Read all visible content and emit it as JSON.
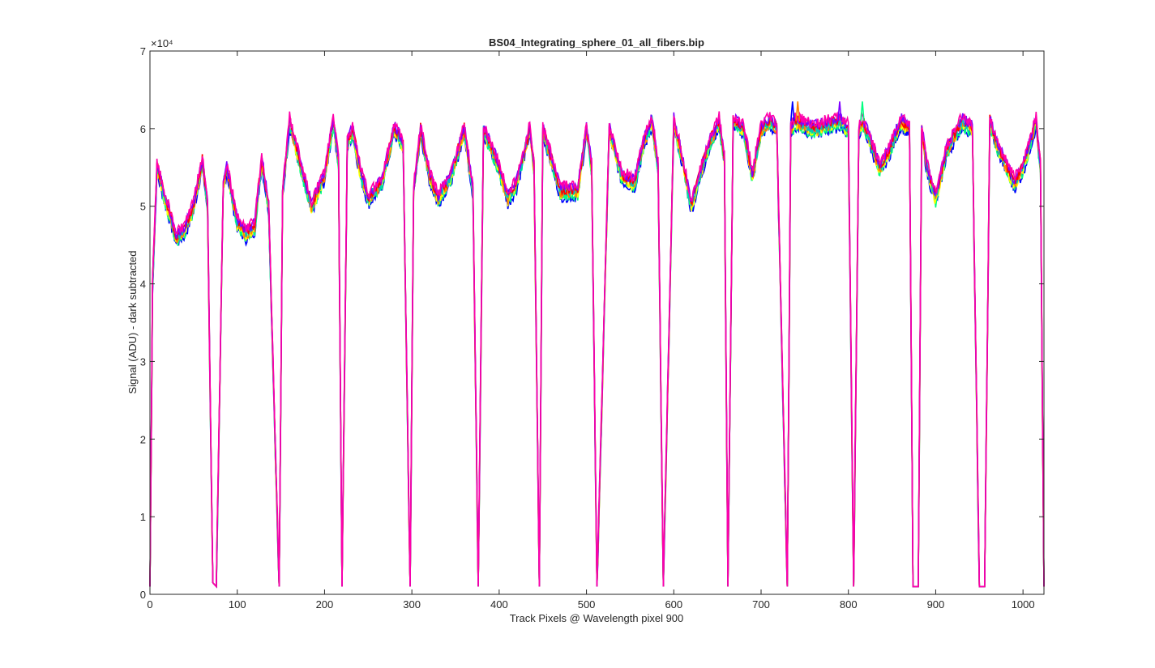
{
  "chart_data": {
    "type": "line",
    "title": "BS04_Integrating_sphere_01_all_fibers.bip",
    "xlabel": "Track Pixels @ Wavelength pixel 900",
    "ylabel": "Signal (ADU) - dark subtracted",
    "xlim": [
      0,
      1024
    ],
    "ylim": [
      0,
      70000
    ],
    "y_exponent_label": "×10⁴",
    "xticks": [
      0,
      100,
      200,
      300,
      400,
      500,
      600,
      700,
      800,
      900,
      1000
    ],
    "yticks": [
      0,
      1,
      2,
      3,
      4,
      5,
      6,
      7
    ],
    "grid": false,
    "colors": [
      "#0000ff",
      "#00ff80",
      "#ffff00",
      "#ff8000",
      "#00c0c0",
      "#ff0000",
      "#8000ff",
      "#ff00aa"
    ],
    "series_count": 8,
    "approx_profile": {
      "x": [
        0,
        3,
        8,
        20,
        30,
        40,
        50,
        60,
        66,
        72,
        76,
        84,
        88,
        100,
        110,
        120,
        128,
        136,
        148,
        152,
        160,
        180,
        185,
        200,
        210,
        216,
        220,
        226,
        232,
        240,
        250,
        265,
        280,
        290,
        298,
        302,
        310,
        320,
        330,
        345,
        360,
        370,
        376,
        382,
        400,
        410,
        420,
        435,
        440,
        446,
        450,
        460,
        470,
        490,
        500,
        506,
        512,
        526,
        540,
        555,
        565,
        575,
        582,
        588,
        600,
        610,
        620,
        640,
        652,
        658,
        662,
        668,
        680,
        690,
        700,
        710,
        718,
        730,
        734,
        740,
        760,
        790,
        800,
        806,
        812,
        816,
        820,
        836,
        846,
        860,
        870,
        874,
        880,
        884,
        890,
        900,
        912,
        930,
        942,
        950,
        956,
        962,
        970,
        990,
        1000,
        1015,
        1020,
        1024
      ],
      "y": [
        1000,
        40000,
        55000,
        50000,
        46000,
        47000,
        50000,
        56000,
        50000,
        1500,
        1000,
        53000,
        55000,
        48000,
        46500,
        47500,
        56000,
        50000,
        1000,
        52000,
        61000,
        52000,
        50000,
        54000,
        61000,
        56000,
        1000,
        58000,
        60000,
        55000,
        51000,
        53000,
        60000,
        58000,
        1000,
        52000,
        60000,
        54000,
        51000,
        54000,
        60000,
        52000,
        1000,
        60000,
        55000,
        51000,
        53000,
        60000,
        55000,
        1000,
        60000,
        56000,
        52000,
        52000,
        60000,
        55000,
        1000,
        60000,
        54000,
        53000,
        58000,
        61000,
        55000,
        1000,
        61000,
        56000,
        50000,
        58000,
        61000,
        56000,
        1000,
        61000,
        60000,
        54000,
        60000,
        61000,
        60000,
        1000,
        60000,
        61000,
        60000,
        61000,
        60000,
        1000,
        60000,
        61000,
        60000,
        55000,
        57000,
        61000,
        60000,
        1000,
        1000,
        60000,
        55000,
        51000,
        57000,
        61000,
        60000,
        1000,
        1000,
        61000,
        58000,
        53000,
        55000,
        61000,
        55000,
        1000
      ],
      "note_spikes": [
        [
          736,
          63500
        ],
        [
          742,
          63500
        ],
        [
          790,
          63500
        ],
        [
          816,
          63500
        ]
      ]
    }
  }
}
